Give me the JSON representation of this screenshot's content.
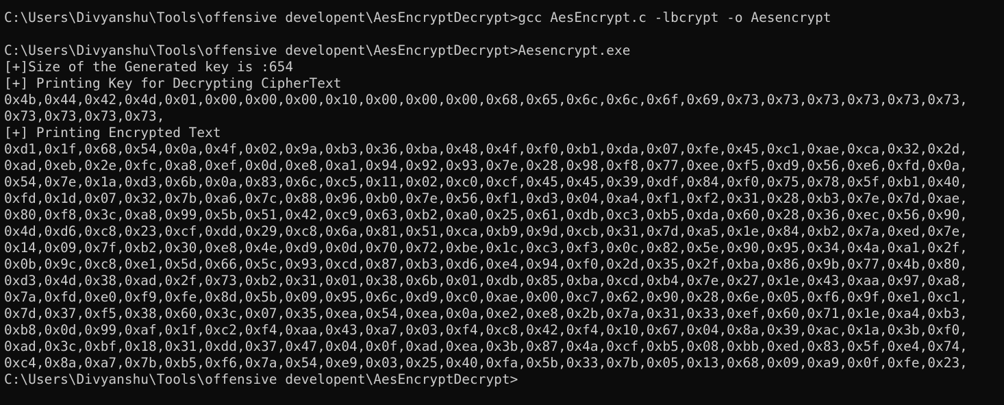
{
  "terminal": {
    "lines": [
      "C:\\Users\\Divyanshu\\Tools\\offensive developent\\AesEncryptDecrypt>gcc AesEncrypt.c -lbcrypt -o Aesencrypt",
      "",
      "C:\\Users\\Divyanshu\\Tools\\offensive developent\\AesEncryptDecrypt>Aesencrypt.exe",
      "[+]Size of the Generated key is :654",
      "[+] Printing Key for Decrypting CipherText",
      "0x4b,0x44,0x42,0x4d,0x01,0x00,0x00,0x00,0x10,0x00,0x00,0x00,0x68,0x65,0x6c,0x6c,0x6f,0x69,0x73,0x73,0x73,0x73,0x73,0x73,",
      "0x73,0x73,0x73,0x73,",
      "[+] Printing Encrypted Text",
      "0xd1,0x1f,0x68,0x54,0x0a,0x4f,0x02,0x9a,0xb3,0x36,0xba,0x48,0x4f,0xf0,0xb1,0xda,0x07,0xfe,0x45,0xc1,0xae,0xca,0x32,0x2d,",
      "0xad,0xeb,0x2e,0xfc,0xa8,0xef,0x0d,0xe8,0xa1,0x94,0x92,0x93,0x7e,0x28,0x98,0xf8,0x77,0xee,0xf5,0xd9,0x56,0xe6,0xfd,0x0a,",
      "0x54,0x7e,0x1a,0xd3,0x6b,0x0a,0x83,0x6c,0xc5,0x11,0x02,0xc0,0xcf,0x45,0x45,0x39,0xdf,0x84,0xf0,0x75,0x78,0x5f,0xb1,0x40,",
      "0xfd,0x1d,0x07,0x32,0x7b,0xa6,0x7c,0x88,0x96,0xb0,0x7e,0x56,0xf1,0xd3,0x04,0xa4,0xf1,0xf2,0x31,0x28,0xb3,0x7e,0x7d,0xae,",
      "0x80,0xf8,0x3c,0xa8,0x99,0x5b,0x51,0x42,0xc9,0x63,0xb2,0xa0,0x25,0x61,0xdb,0xc3,0xb5,0xda,0x60,0x28,0x36,0xec,0x56,0x90,",
      "0x4d,0xd6,0xc8,0x23,0xcf,0xdd,0x29,0xc8,0x6a,0x81,0x51,0xca,0xb9,0x9d,0xcb,0x31,0x7d,0xa5,0x1e,0x84,0xb2,0x7a,0xed,0x7e,",
      "0x14,0x09,0x7f,0xb2,0x30,0xe8,0x4e,0xd9,0x0d,0x70,0x72,0xbe,0x1c,0xc3,0xf3,0x0c,0x82,0x5e,0x90,0x95,0x34,0x4a,0xa1,0x2f,",
      "0x0b,0x9c,0xc8,0xe1,0x5d,0x66,0x5c,0x93,0xcd,0x87,0xb3,0xd6,0xe4,0x94,0xf0,0x2d,0x35,0x2f,0xba,0x86,0x9b,0x77,0x4b,0x80,",
      "0xd3,0x4d,0x38,0xad,0x2f,0x73,0xb2,0x31,0x01,0x38,0x6b,0x01,0xdb,0x85,0xba,0xcd,0xb4,0x7e,0x27,0x1e,0x43,0xaa,0x97,0xa8,",
      "0x7a,0xfd,0xe0,0xf9,0xfe,0x8d,0x5b,0x09,0x95,0x6c,0xd9,0xc0,0xae,0x00,0xc7,0x62,0x90,0x28,0x6e,0x05,0xf6,0x9f,0xe1,0xc1,",
      "0x7d,0x37,0xf5,0x38,0x60,0x3c,0x07,0x35,0xea,0x54,0xea,0x0a,0xe2,0xe8,0x2b,0x7a,0x31,0x33,0xef,0x60,0x71,0x1e,0xa4,0xb3,",
      "0xb8,0x0d,0x99,0xaf,0x1f,0xc2,0xf4,0xaa,0x43,0xa7,0x03,0xf4,0xc8,0x42,0xf4,0x10,0x67,0x04,0x8a,0x39,0xac,0x1a,0x3b,0xf0,",
      "0xad,0x3c,0xbf,0x18,0x31,0xdd,0x37,0x47,0x04,0x0f,0xad,0xea,0x3b,0x87,0x4a,0xcf,0xb5,0x08,0xbb,0xed,0x83,0x5f,0xe4,0x74,",
      "0xc4,0x8a,0xa7,0x7b,0xb5,0xf6,0x7a,0x54,0xe9,0x03,0x25,0x40,0xfa,0x5b,0x33,0x7b,0x05,0x13,0x68,0x09,0xa9,0x0f,0xfe,0x23,",
      "C:\\Users\\Divyanshu\\Tools\\offensive developent\\AesEncryptDecrypt>"
    ]
  },
  "colors": {
    "background": "#0c0c0c",
    "text": "#cccccc"
  }
}
